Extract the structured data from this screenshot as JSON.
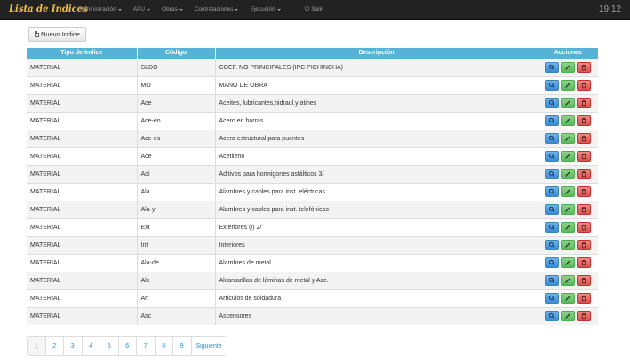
{
  "app": {
    "brand": "Lista de Indices",
    "menu": [
      {
        "label": "Administración",
        "dropdown": true
      },
      {
        "label": "APU",
        "dropdown": true
      },
      {
        "label": "Obras",
        "dropdown": true
      },
      {
        "label": "Contrataciones",
        "dropdown": true
      },
      {
        "label": "Ejecución",
        "dropdown": true
      }
    ],
    "logout": {
      "label": "Salir",
      "icon": "power-icon"
    },
    "clock": "19:12"
  },
  "toolbar": {
    "new_label": "Nuevo Indice",
    "new_icon": "document-icon"
  },
  "table": {
    "headers": [
      "Tipo de Indice",
      "Código",
      "Descripción",
      "Acciones"
    ],
    "rows": [
      {
        "tipo": "MATERIAL",
        "codigo": "SLDO",
        "descripcion": "COEF. NO PRINCIPALES (IPC PICHINCHA)"
      },
      {
        "tipo": "MATERIAL",
        "codigo": "MO",
        "descripcion": "MANO DE OBRA"
      },
      {
        "tipo": "MATERIAL",
        "codigo": "Ace",
        "descripcion": "Aceites, lubricantes,hidraul.y atines"
      },
      {
        "tipo": "MATERIAL",
        "codigo": "Ace-en",
        "descripcion": "Acero en barras"
      },
      {
        "tipo": "MATERIAL",
        "codigo": "Ace-es",
        "descripcion": "Acero estructural para puentes"
      },
      {
        "tipo": "MATERIAL",
        "codigo": "Ace",
        "descripcion": "Acetileno"
      },
      {
        "tipo": "MATERIAL",
        "codigo": "Adi",
        "descripcion": "Aditivos para hormigones asfálticos 3/"
      },
      {
        "tipo": "MATERIAL",
        "codigo": "Ala",
        "descripcion": "Alambres y cables para inst. eléctricas"
      },
      {
        "tipo": "MATERIAL",
        "codigo": "Ala-y",
        "descripcion": "Alambres y cables para inst. telefónicas"
      },
      {
        "tipo": "MATERIAL",
        "codigo": "Ext",
        "descripcion": "Exteriores (I) 2/"
      },
      {
        "tipo": "MATERIAL",
        "codigo": "Int",
        "descripcion": "Interiores"
      },
      {
        "tipo": "MATERIAL",
        "codigo": "Ala-de",
        "descripcion": "Alambres de metal"
      },
      {
        "tipo": "MATERIAL",
        "codigo": "Alc",
        "descripcion": "Alcantarillas de láminas de metal y Acc."
      },
      {
        "tipo": "MATERIAL",
        "codigo": "Art",
        "descripcion": "Artículos de soldadura"
      },
      {
        "tipo": "MATERIAL",
        "codigo": "Asc",
        "descripcion": "Ascensores"
      }
    ],
    "actions": [
      {
        "name": "view",
        "icon": "search-icon",
        "color": "#428bca"
      },
      {
        "name": "edit",
        "icon": "pencil-icon",
        "color": "#5cb85c"
      },
      {
        "name": "delete",
        "icon": "trash-icon",
        "color": "#d9534f"
      }
    ]
  },
  "pagination": {
    "pages": [
      "1",
      "2",
      "3",
      "4",
      "5",
      "6",
      "7",
      "8",
      "9"
    ],
    "active": "1",
    "next_label": "Siguiente"
  }
}
